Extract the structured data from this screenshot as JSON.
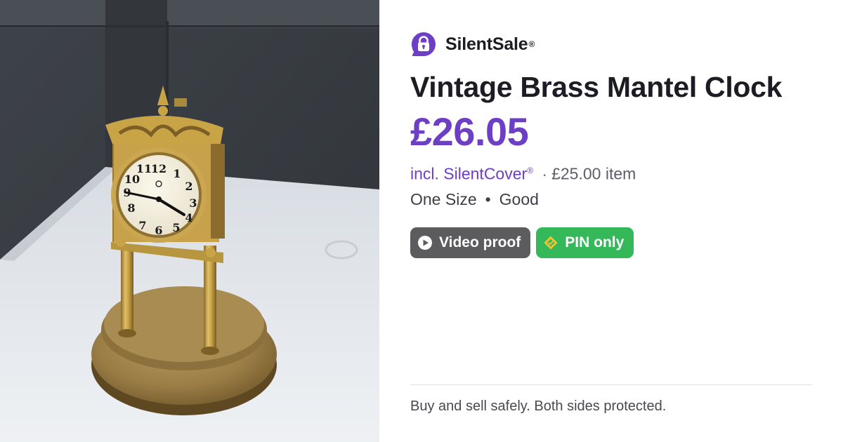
{
  "photo": {
    "description_icon": "product-photo",
    "clock_numerals": [
      "12",
      "1",
      "2",
      "3",
      "4",
      "5",
      "6",
      "7",
      "8",
      "9",
      "10",
      "11"
    ]
  },
  "brand": {
    "name": "SilentSale",
    "registered_mark": "®",
    "logo_icon": "padlock-chat-bubble-icon",
    "logo_color": "#6c3fc4"
  },
  "listing": {
    "title": "Vintage Brass Mantel Clock",
    "price": "£26.05",
    "price_color": "#6c3fc4",
    "cover": {
      "label": "incl. SilentCover",
      "registered_mark": "®",
      "separator": "·",
      "item_price": "£25.00 item"
    },
    "size": "One Size",
    "meta_separator": "•",
    "condition": "Good"
  },
  "badges": [
    {
      "label": "Video proof",
      "icon": "play-circle-icon",
      "color": "#5c5c5e"
    },
    {
      "label": "PIN only",
      "icon": "diamond-tag-icon",
      "color": "#35b85a"
    }
  ],
  "footer": {
    "tagline": "Buy and sell safely. Both sides protected."
  }
}
